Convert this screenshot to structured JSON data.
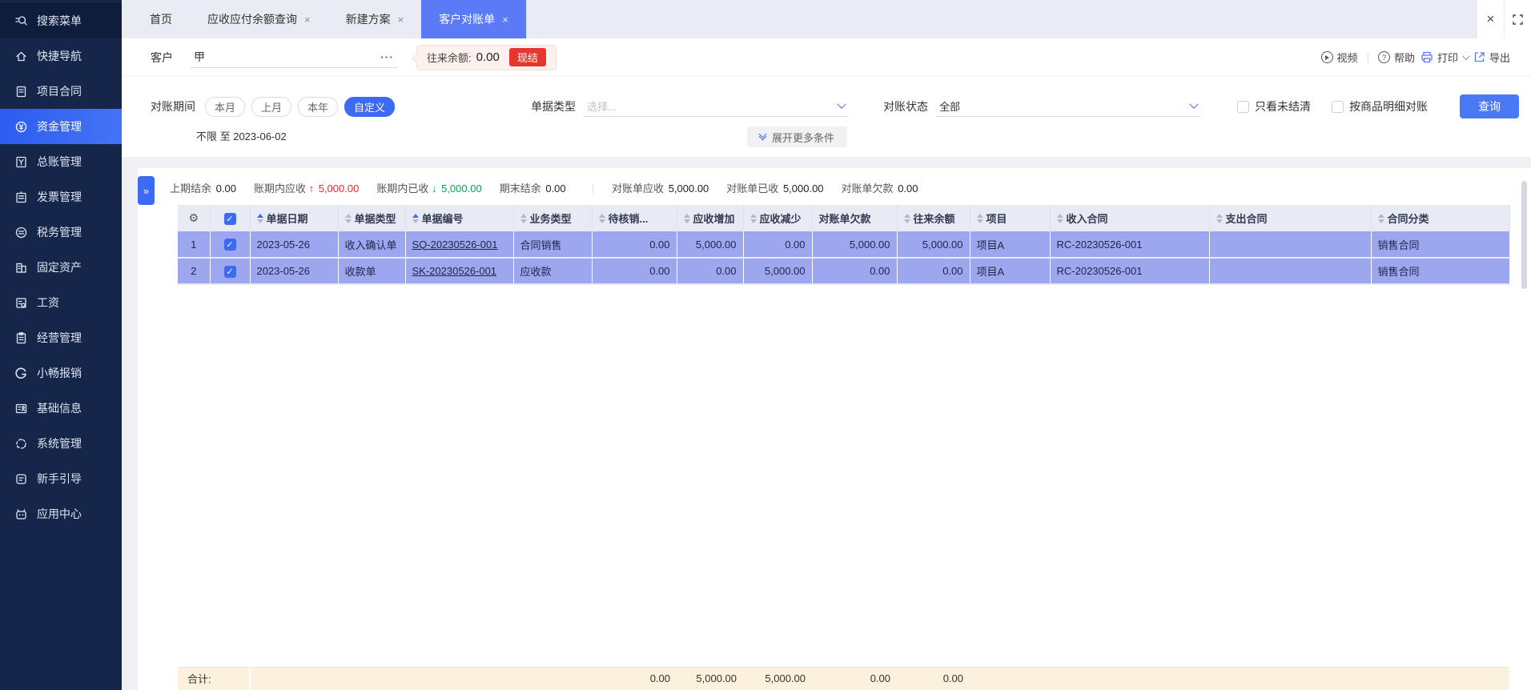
{
  "window": {
    "close": "×"
  },
  "icons": {
    "gear": "⚙",
    "check": "✓",
    "expander": "»",
    "up": "↑",
    "down": "↓",
    "question": "?"
  },
  "sidebar": {
    "items": [
      {
        "label": "搜索菜单"
      },
      {
        "label": "快捷导航"
      },
      {
        "label": "项目合同"
      },
      {
        "label": "资金管理"
      },
      {
        "label": "总账管理"
      },
      {
        "label": "发票管理"
      },
      {
        "label": "税务管理"
      },
      {
        "label": "固定资产"
      },
      {
        "label": "工资"
      },
      {
        "label": "经营管理"
      },
      {
        "label": "小畅报销"
      },
      {
        "label": "基础信息"
      },
      {
        "label": "系统管理"
      },
      {
        "label": "新手引导"
      },
      {
        "label": "应用中心"
      }
    ]
  },
  "tabs": {
    "home": "首页",
    "tab1": "应收应付余额查询",
    "tab2": "新建方案",
    "tab3": "客户对账单",
    "close": "×"
  },
  "toolbar": {
    "customer_label": "客户",
    "customer_value": "甲",
    "more": "···",
    "balance_label": "往来余额:",
    "balance_value": "0.00",
    "settle_badge": "现结",
    "video": "视频",
    "help": "帮助",
    "print": "打印",
    "export": "导出"
  },
  "filters": {
    "period_label": "对账期间",
    "month": "本月",
    "last_month": "上月",
    "year": "本年",
    "custom": "自定义",
    "range": "不限 至 2023-06-02",
    "doc_type_label": "单据类型",
    "doc_type_placeholder": "选择...",
    "status_label": "对账状态",
    "status_value": "全部",
    "only_unsettled": "只看未结清",
    "by_product": "按商品明细对账",
    "query": "查询",
    "expand_more": "展开更多条件"
  },
  "summary": {
    "prev_label": "上期结余",
    "prev_value": "0.00",
    "recv_label": "账期内应收",
    "recv_value": "5,000.00",
    "paid_label": "账期内已收",
    "paid_value": "5,000.00",
    "end_label": "期末结余",
    "end_value": "0.00",
    "stmt_recv_label": "对账单应收",
    "stmt_recv_value": "5,000.00",
    "stmt_paid_label": "对账单已收",
    "stmt_paid_value": "5,000.00",
    "stmt_owed_label": "对账单欠款",
    "stmt_owed_value": "0.00"
  },
  "table": {
    "columns": {
      "date": "单据日期",
      "type": "单据类型",
      "no": "单据编号",
      "biz": "业务类型",
      "pending": "待核销...",
      "inc": "应收增加",
      "dec": "应收减少",
      "owed": "对账单欠款",
      "bal": "往来余额",
      "project": "项目",
      "income": "收入合同",
      "expense": "支出合同",
      "category": "合同分类"
    },
    "rows": [
      {
        "num": "1",
        "date": "2023-05-26",
        "type": "收入确认单",
        "no": "SQ-20230526-001",
        "biz": "合同销售",
        "pending": "0.00",
        "inc": "5,000.00",
        "dec": "0.00",
        "owed": "5,000.00",
        "bal": "5,000.00",
        "project": "项目A",
        "income": "RC-20230526-001",
        "expense": "",
        "category": "销售合同"
      },
      {
        "num": "2",
        "date": "2023-05-26",
        "type": "收款单",
        "no": "SK-20230526-001",
        "biz": "应收款",
        "pending": "0.00",
        "inc": "0.00",
        "dec": "5,000.00",
        "owed": "0.00",
        "bal": "0.00",
        "project": "项目A",
        "income": "RC-20230526-001",
        "expense": "",
        "category": "销售合同"
      }
    ],
    "footer": {
      "label": "合计:",
      "pending": "0.00",
      "inc": "5,000.00",
      "dec": "5,000.00",
      "owed": "0.00",
      "bal": "0.00"
    }
  },
  "colors": {
    "accent": "#3d6af2",
    "active_tab": "#5a7af8",
    "row_bg": "#9da7ef",
    "red": "#f5222d",
    "green": "#00a854",
    "badge_red": "#e7362e",
    "footer_bg": "#fcf1dc",
    "sidebar_bg": "#16254a"
  }
}
